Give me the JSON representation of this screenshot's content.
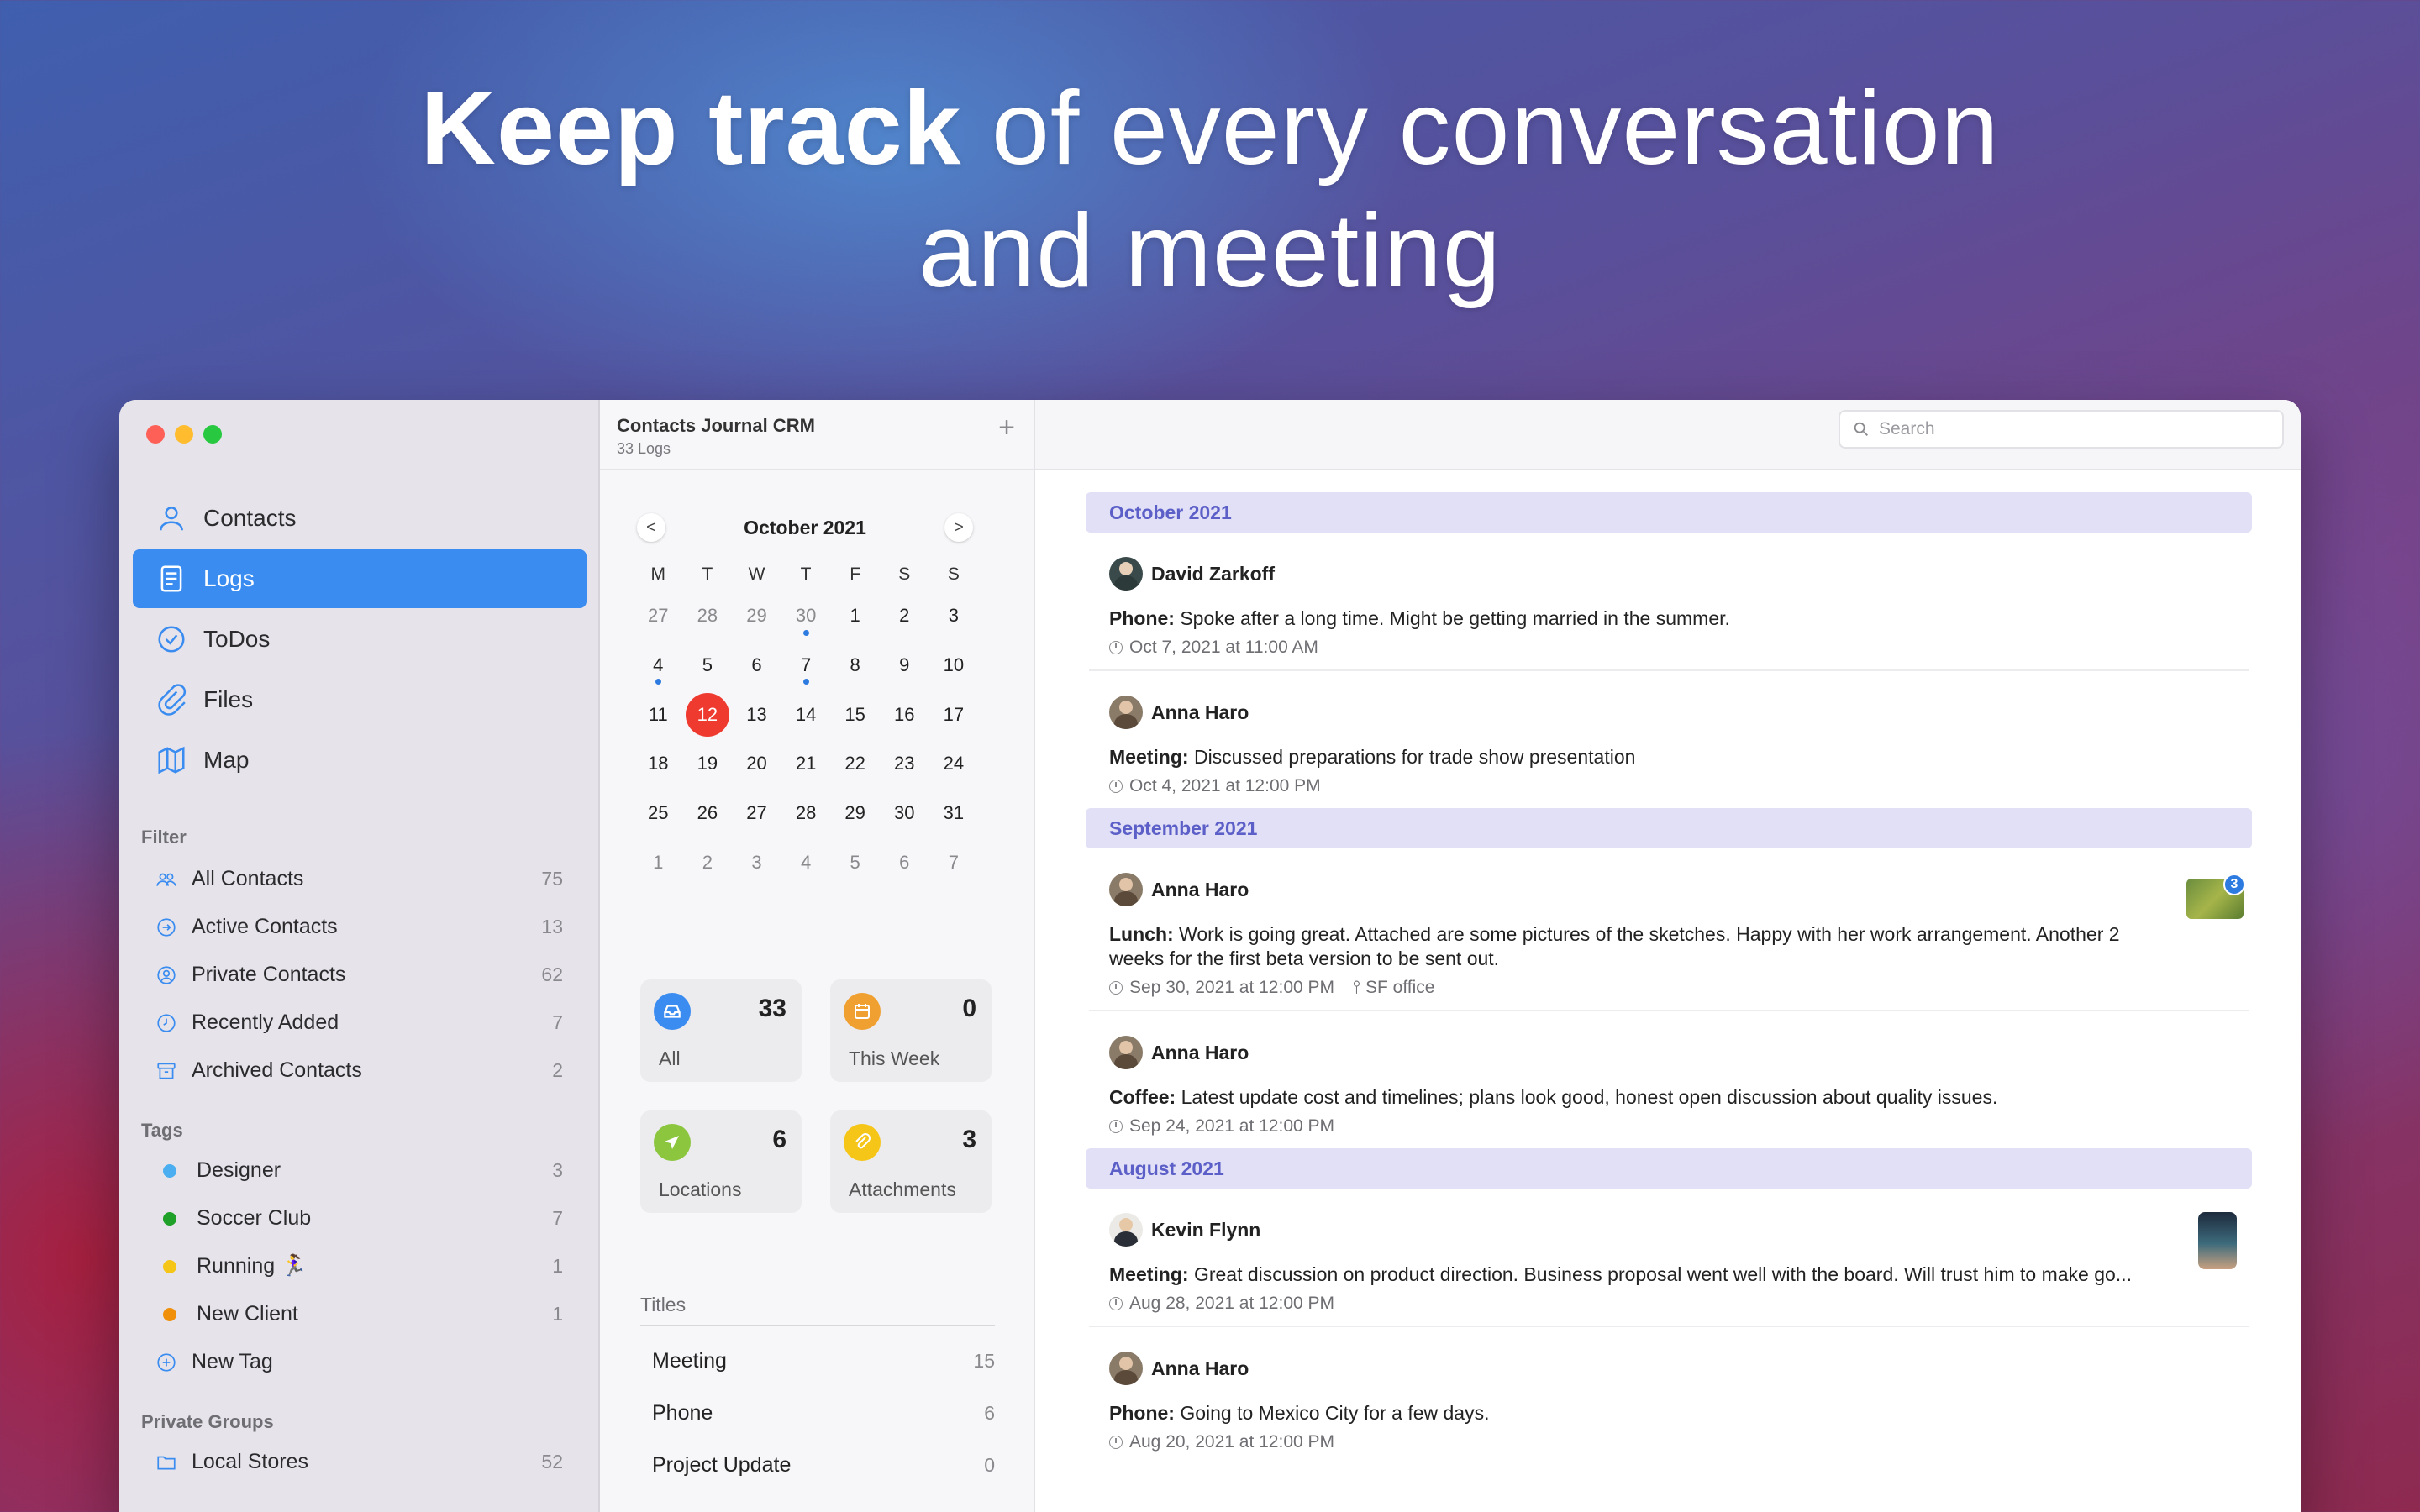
{
  "headline": {
    "bold": "Keep track",
    "rest_line1": " of every conversation",
    "rest_line2": "and meeting"
  },
  "colors": {
    "accent": "#3b8cf0",
    "today": "#ef3a2f",
    "month_bar": "#e1e0f6",
    "month_text": "#5b5fc7"
  },
  "sidebar": {
    "nav": [
      {
        "label": "Contacts",
        "icon": "person-icon"
      },
      {
        "label": "Logs",
        "icon": "document-icon",
        "active": true
      },
      {
        "label": "ToDos",
        "icon": "checkmark-circle-icon"
      },
      {
        "label": "Files",
        "icon": "paperclip-icon"
      },
      {
        "label": "Map",
        "icon": "map-icon"
      }
    ],
    "filter_label": "Filter",
    "filters": [
      {
        "label": "All Contacts",
        "count": "75",
        "icon": "people-icon"
      },
      {
        "label": "Active Contacts",
        "count": "13",
        "icon": "arrow-circle-icon"
      },
      {
        "label": "Private Contacts",
        "count": "62",
        "icon": "person-circle-icon"
      },
      {
        "label": "Recently Added",
        "count": "7",
        "icon": "clock-icon"
      },
      {
        "label": "Archived Contacts",
        "count": "2",
        "icon": "archive-box-icon"
      }
    ],
    "tags_label": "Tags",
    "tags": [
      {
        "label": "Designer",
        "count": "3",
        "color": "#4aaef0"
      },
      {
        "label": "Soccer Club",
        "count": "7",
        "color": "#1fa028"
      },
      {
        "label": "Running 🏃‍♀️",
        "count": "1",
        "color": "#f5c518"
      },
      {
        "label": "New Client",
        "count": "1",
        "color": "#f0900a"
      }
    ],
    "new_tag_label": "New Tag",
    "groups_label": "Private Groups",
    "groups": [
      {
        "label": "Local Stores",
        "count": "52",
        "icon": "folder-icon"
      }
    ]
  },
  "mid": {
    "title": "Contacts Journal CRM",
    "subtitle": "33 Logs",
    "calendar": {
      "month": "October 2021",
      "prev": "<",
      "next": ">",
      "dow": [
        "M",
        "T",
        "W",
        "T",
        "F",
        "S",
        "S"
      ],
      "weeks": [
        [
          "27",
          "28",
          "29",
          "30",
          "1",
          "2",
          "3"
        ],
        [
          "4",
          "5",
          "6",
          "7",
          "8",
          "9",
          "10"
        ],
        [
          "11",
          "12",
          "13",
          "14",
          "15",
          "16",
          "17"
        ],
        [
          "18",
          "19",
          "20",
          "21",
          "22",
          "23",
          "24"
        ],
        [
          "25",
          "26",
          "27",
          "28",
          "29",
          "30",
          "31"
        ],
        [
          "1",
          "2",
          "3",
          "4",
          "5",
          "6",
          "7"
        ]
      ],
      "today": "12",
      "dotted_days": [
        "30",
        "4",
        "7"
      ]
    },
    "stats": [
      {
        "label": "All",
        "value": "33",
        "icon": "tray-icon",
        "color": "#3b8cf0"
      },
      {
        "label": "This Week",
        "value": "0",
        "icon": "calendar-icon",
        "color": "#f0a030"
      },
      {
        "label": "Locations",
        "value": "6",
        "icon": "location-arrow-icon",
        "color": "#8cc63f"
      },
      {
        "label": "Attachments",
        "value": "3",
        "icon": "paperclip-icon",
        "color": "#f5c518"
      }
    ],
    "titles_label": "Titles",
    "titles": [
      {
        "label": "Meeting",
        "count": "15"
      },
      {
        "label": "Phone",
        "count": "6"
      },
      {
        "label": "Project Update",
        "count": "0"
      }
    ]
  },
  "search": {
    "placeholder": "Search"
  },
  "feed": [
    {
      "month": "October 2021",
      "entries": [
        {
          "name": "David Zarkoff",
          "kind": "Phone:",
          "text": " Spoke after a long time. Might be getting married in the summer.",
          "date": "Oct 7, 2021 at 11:00 AM"
        },
        {
          "name": "Anna Haro",
          "kind": "Meeting:",
          "text": " Discussed preparations for trade show presentation",
          "date": "Oct 4, 2021 at 12:00 PM"
        }
      ]
    },
    {
      "month": "September 2021",
      "entries": [
        {
          "name": "Anna Haro",
          "kind": "Lunch:",
          "text": " Work is going great. Attached are some pictures of the sketches. Happy with her work arrangement. Another 2 weeks for the first beta version to be sent out.",
          "date": "Sep 30, 2021 at 12:00 PM",
          "location": "SF office",
          "attachments": "3"
        },
        {
          "name": "Anna Haro",
          "kind": "Coffee:",
          "text": " Latest update cost and timelines; plans look good, honest open discussion about quality issues.",
          "date": "Sep 24, 2021 at 12:00 PM"
        }
      ]
    },
    {
      "month": "August 2021",
      "entries": [
        {
          "name": "Kevin Flynn",
          "kind": "Meeting:",
          "text": " Great discussion on product direction. Business proposal went well with the board. Will trust him to make go...",
          "date": "Aug 28, 2021 at 12:00 PM",
          "photo": true
        },
        {
          "name": "Anna Haro",
          "kind": "Phone:",
          "text": " Going to Mexico City for a few days.",
          "date": "Aug 20, 2021 at 12:00 PM"
        }
      ]
    }
  ]
}
